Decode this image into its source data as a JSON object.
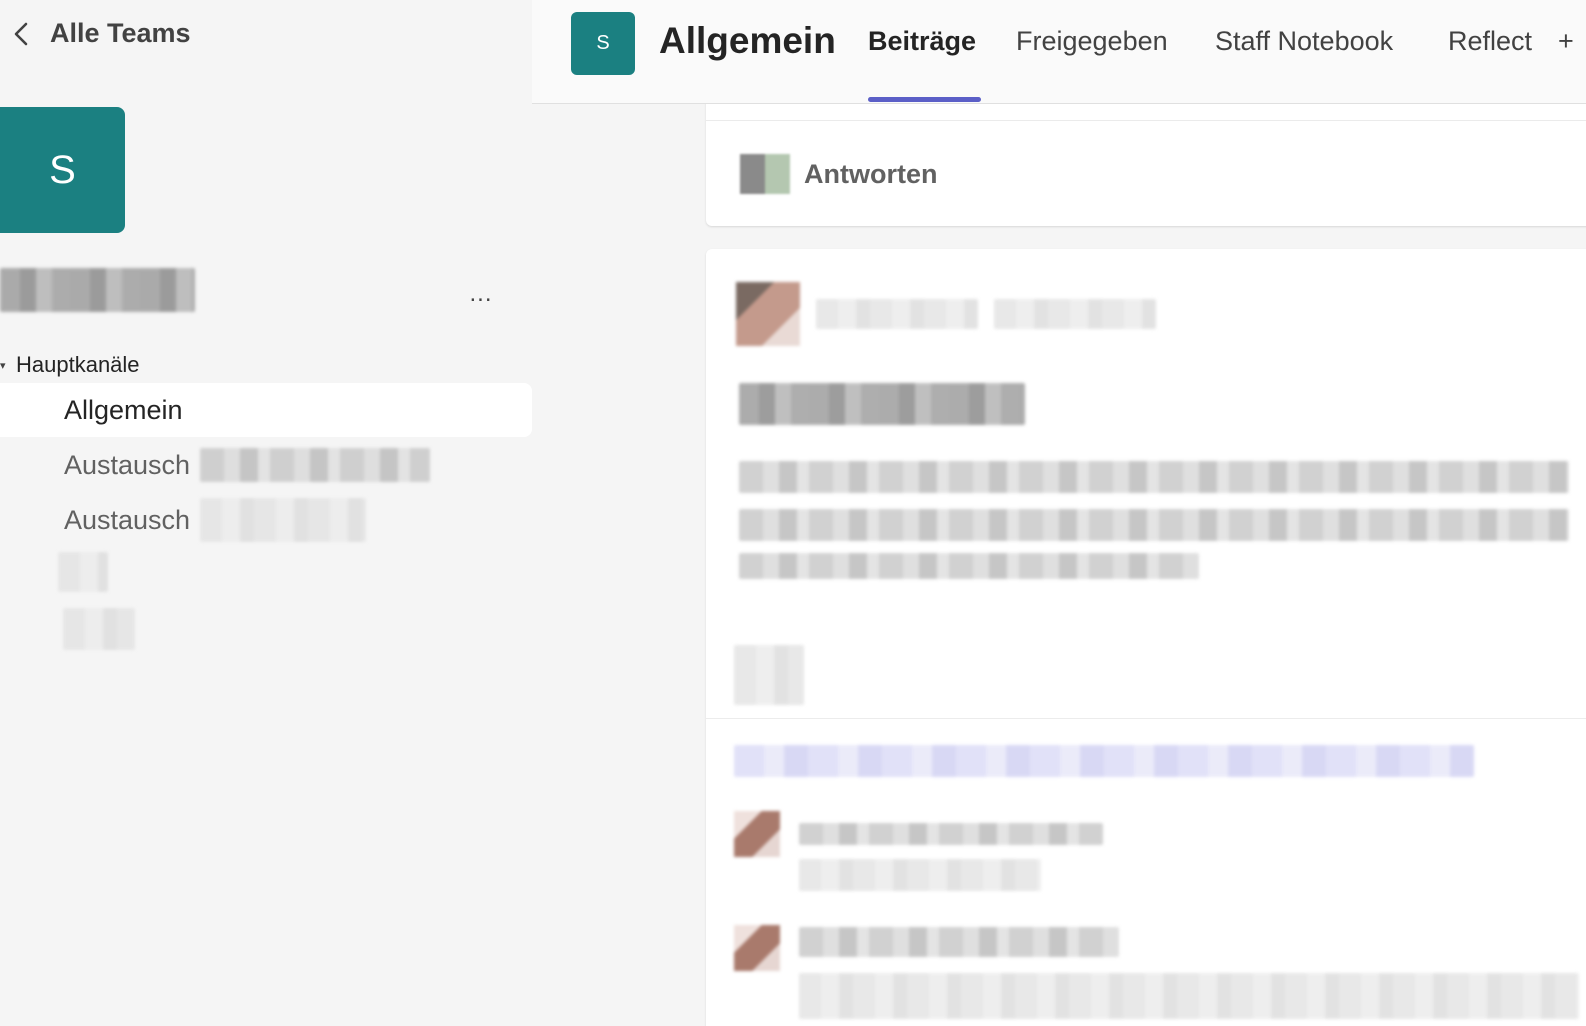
{
  "colors": {
    "team_teal": "#1b8081",
    "accent": "#5b5fc7"
  },
  "sidebar": {
    "back_label": "Alle Teams",
    "team_initial": "S",
    "more_label": "...",
    "section_label": "Hauptkanäle",
    "channels": [
      {
        "label": "Allgemein"
      },
      {
        "label": "Austausch"
      },
      {
        "label": "Austausch"
      }
    ]
  },
  "header": {
    "team_initial": "S",
    "title": "Allgemein",
    "tabs": [
      {
        "label": "Beiträge"
      },
      {
        "label": "Freigegeben"
      },
      {
        "label": "Staff Notebook"
      },
      {
        "label": "Reflect"
      }
    ],
    "add_tab": "+"
  },
  "feed": {
    "reply_label": "Antworten"
  }
}
